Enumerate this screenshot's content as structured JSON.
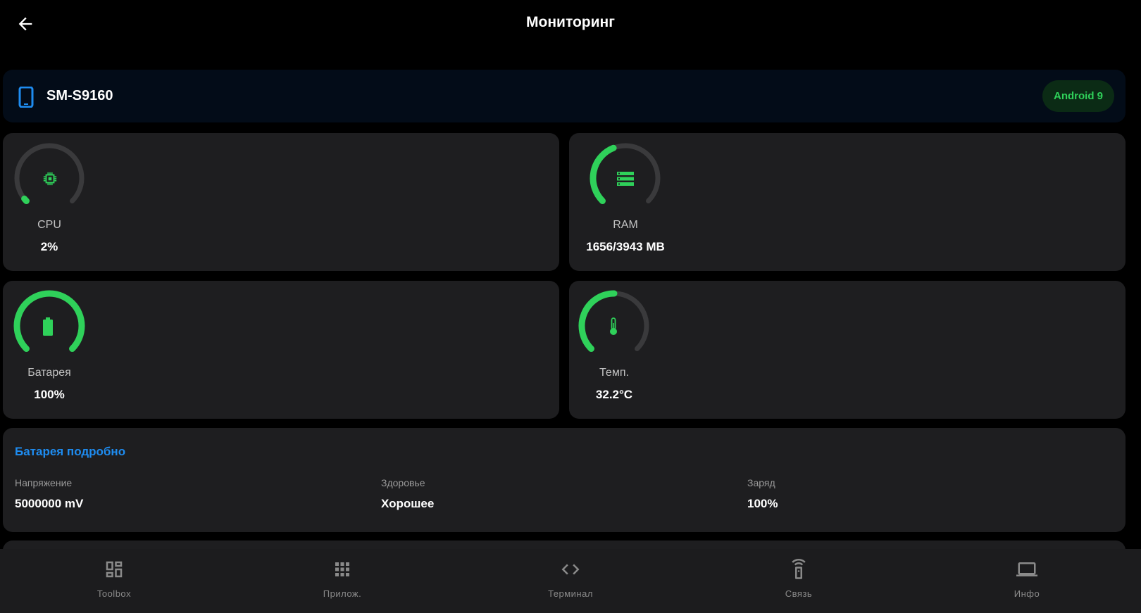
{
  "header": {
    "title": "Мониторинг"
  },
  "device": {
    "name": "SM-S9160",
    "badge": "Android 9"
  },
  "colors": {
    "accent_green": "#2fd15a",
    "accent_blue": "#1e8cf0",
    "track": "#3a3a3c",
    "card": "#1e1e20",
    "device_card": "#030c18"
  },
  "metrics": [
    {
      "id": "cpu",
      "label": "CPU",
      "value": "2%",
      "fraction": 0.02,
      "icon": "cpu-chip-icon"
    },
    {
      "id": "ram",
      "label": "RAM",
      "value": "1656/3943 MB",
      "fraction": 0.42,
      "icon": "memory-icon"
    },
    {
      "id": "battery",
      "label": "Батарея",
      "value": "100%",
      "fraction": 1.0,
      "icon": "battery-icon"
    },
    {
      "id": "temp",
      "label": "Темп.",
      "value": "32.2°C",
      "fraction": 0.5,
      "icon": "thermometer-icon"
    }
  ],
  "battery_details": {
    "title": "Батарея подробно",
    "items": [
      {
        "label": "Напряжение",
        "value": "5000000 mV"
      },
      {
        "label": "Здоровье",
        "value": "Хорошее"
      },
      {
        "label": "Заряд",
        "value": "100%"
      }
    ]
  },
  "nav": [
    {
      "label": "Toolbox",
      "icon": "dashboard-icon"
    },
    {
      "label": "Прилож.",
      "icon": "apps-grid-icon"
    },
    {
      "label": "Терминал",
      "icon": "code-icon"
    },
    {
      "label": "Связь",
      "icon": "remote-icon"
    },
    {
      "label": "Инфо",
      "icon": "laptop-icon"
    }
  ]
}
